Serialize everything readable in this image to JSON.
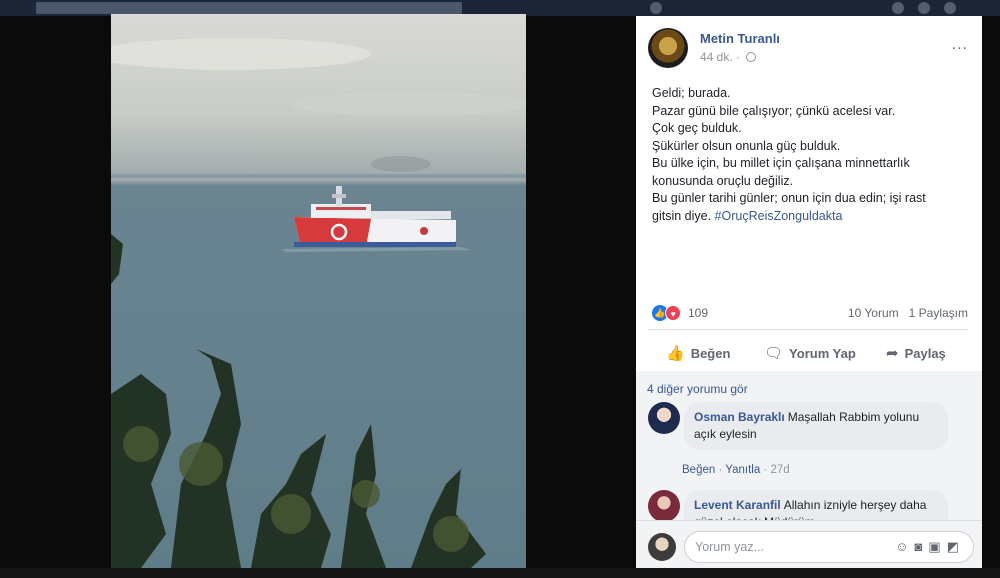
{
  "post": {
    "author": "Metin Turanlı",
    "time": "44 dk. ·",
    "text_lines": [
      "Geldi; burada.",
      "Pazar günü bile çalışıyor; çünkü acelesi var.",
      "Çok geç bulduk.",
      "Şükürler olsun onunla güç bulduk.",
      "Bu ülke için, bu millet için çalışana minnettarlık",
      "konusunda oruçlu değiliz.",
      "Bu günler tarihi günler; onun için dua edin; işi rast",
      "gitsin diye."
    ],
    "hashtag": "#OruçReisZonguldakta",
    "reaction_count": "109",
    "comments_count": "10 Yorum",
    "shares_count": "1 Paylaşım",
    "more_icon": "..."
  },
  "actions": {
    "like": "Beğen",
    "comment": "Yorum Yap",
    "share": "Paylaş"
  },
  "comments": {
    "more_label": "4 diğer yorumu gör",
    "items": [
      {
        "name": "Osman Bayraklı",
        "text": "Maşallah Rabbim yolunu açık eylesin",
        "like": "Beğen",
        "reply": "Yanıtla",
        "age": "27d"
      },
      {
        "name": "Levent Karanfil",
        "text": "Allahın izniyle herşey daha güzel olacak Müdürüm"
      }
    ]
  },
  "composer": {
    "placeholder": "Yorum yaz..."
  },
  "colors": {
    "link": "#385898",
    "like_blue": "#1877f2",
    "love_red": "#f33e58"
  },
  "icons": [
    "globe-icon",
    "more-options-icon",
    "like-icon",
    "comment-icon",
    "share-icon",
    "emoji-icon",
    "camera-icon",
    "gif-icon",
    "sticker-icon"
  ]
}
